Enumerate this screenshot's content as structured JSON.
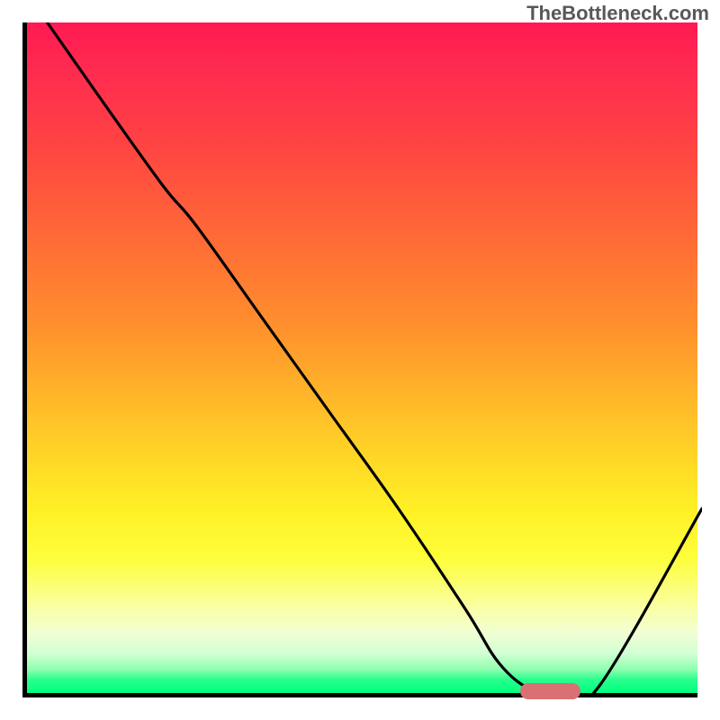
{
  "watermark": "TheBottleneck.com",
  "chart_data": {
    "type": "line",
    "title": "",
    "xlabel": "",
    "ylabel": "",
    "xlim": [
      0,
      100
    ],
    "ylim": [
      0,
      100
    ],
    "gradient_stops": [
      {
        "pos": 0,
        "color": "#ff1a52"
      },
      {
        "pos": 18,
        "color": "#ff4343"
      },
      {
        "pos": 45,
        "color": "#ff8f2d"
      },
      {
        "pos": 73,
        "color": "#fff126"
      },
      {
        "pos": 94,
        "color": "#d3ffd4"
      },
      {
        "pos": 100,
        "color": "#00ff7f"
      }
    ],
    "series": [
      {
        "name": "bottleneck-curve",
        "x": [
          3,
          10,
          20,
          25,
          35,
          45,
          55,
          65,
          70,
          75,
          80,
          85,
          100
        ],
        "y": [
          100,
          90,
          76,
          70,
          56,
          42,
          28,
          13,
          5,
          1,
          0.5,
          2,
          28
        ]
      }
    ],
    "marker": {
      "name": "optimal-range",
      "x_start": 73,
      "x_end": 82,
      "y": 1,
      "color": "#d97174"
    }
  }
}
